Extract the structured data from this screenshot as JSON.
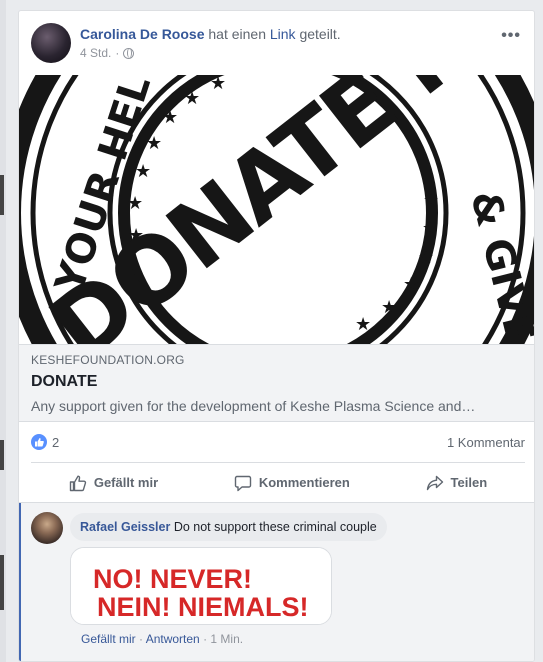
{
  "post": {
    "author": "Carolina De Roose",
    "action_pre": "hat einen",
    "action_link": "Link",
    "action_post": "geteilt.",
    "time": "4 Std.",
    "separator": "·",
    "more": "•••"
  },
  "link_image": {
    "main_text": "DONATE NOW",
    "ring_text_left": "YOUR HEL",
    "ring_text_right": "& GIVE"
  },
  "link": {
    "domain": "KESHEFOUNDATION.ORG",
    "title": "DONATE",
    "description": "Any support given for the development of Keshe Plasma Science and…"
  },
  "reactions": {
    "like_count": "2",
    "comment_count": "1 Kommentar"
  },
  "actions": {
    "like": "Gefällt mir",
    "comment": "Kommentieren",
    "share": "Teilen"
  },
  "comment": {
    "author": "Rafael Geissler",
    "text": "Do not support these criminal couple",
    "image_line1": "NO! NEVER!",
    "image_line2": "NEIN! NIEMALS!",
    "like": "Gefällt mir",
    "dot": "·",
    "reply": "Antworten",
    "time": "1 Min."
  },
  "colors": {
    "link_blue": "#365899",
    "facebook_blue": "#4267b2",
    "like_blue": "#5890ff",
    "meme_red": "#d62828"
  }
}
